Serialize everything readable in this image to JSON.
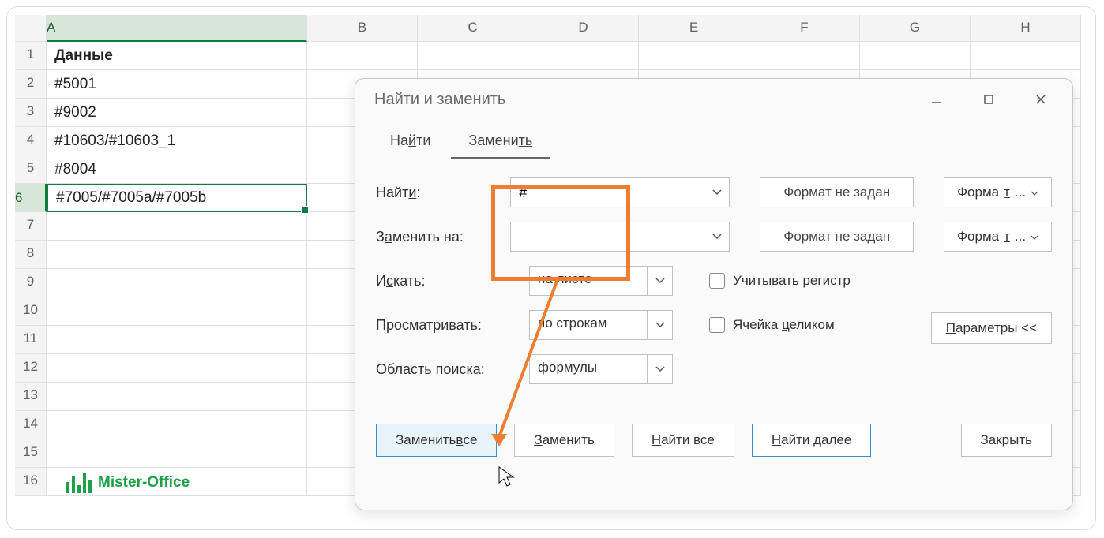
{
  "columns": [
    "",
    "A",
    "B",
    "C",
    "D",
    "E",
    "F",
    "G",
    "H"
  ],
  "rows": [
    {
      "num": "1",
      "a": "Данные",
      "bold": true
    },
    {
      "num": "2",
      "a": "#5001"
    },
    {
      "num": "3",
      "a": "#9002"
    },
    {
      "num": "4",
      "a": "#10603/#10603_1"
    },
    {
      "num": "5",
      "a": "#8004"
    },
    {
      "num": "6",
      "a": "#7005/#7005a/#7005b",
      "selected": true
    },
    {
      "num": "7",
      "a": ""
    },
    {
      "num": "8",
      "a": ""
    },
    {
      "num": "9",
      "a": ""
    },
    {
      "num": "10",
      "a": ""
    },
    {
      "num": "11",
      "a": ""
    },
    {
      "num": "12",
      "a": ""
    },
    {
      "num": "13",
      "a": ""
    },
    {
      "num": "14",
      "a": ""
    },
    {
      "num": "15",
      "a": ""
    },
    {
      "num": "16",
      "a": ""
    }
  ],
  "logo": "Mister-Office",
  "dialog": {
    "title": "Найти и заменить",
    "tabs": {
      "find": "Найти",
      "replace": "Заменить"
    },
    "labels": {
      "find": "Найти:",
      "replace": "Заменить на:",
      "search_in": "Искать:",
      "view": "Просматривать:",
      "area": "Область поиска:"
    },
    "find_value": "#",
    "replace_value": "",
    "search_in_value": "на листе",
    "view_value": "по строкам",
    "area_value": "формулы",
    "format_not_set": "Формат не задан",
    "format_btn": "Формат...",
    "chk_case": "Учитывать регистр",
    "chk_whole": "Ячейка целиком",
    "params": "Параметры <<",
    "buttons": {
      "replace_all": "Заменить все",
      "replace": "Заменить",
      "find_all": "Найти все",
      "find_next": "Найти далее",
      "close": "Закрыть"
    }
  }
}
